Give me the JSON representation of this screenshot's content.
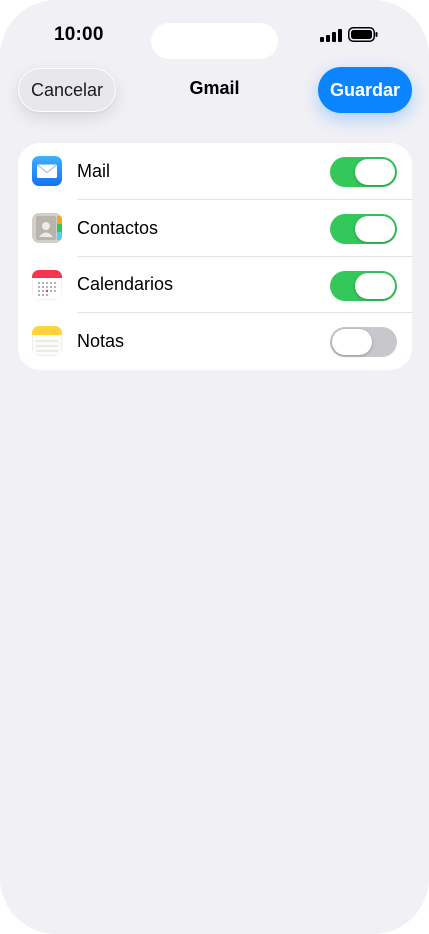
{
  "status_bar": {
    "time": "10:00"
  },
  "nav": {
    "cancel_label": "Cancelar",
    "title": "Gmail",
    "save_label": "Guardar"
  },
  "sync_items": [
    {
      "label": "Mail",
      "icon": "mail-icon",
      "enabled": true
    },
    {
      "label": "Contactos",
      "icon": "contacts-icon",
      "enabled": true
    },
    {
      "label": "Calendarios",
      "icon": "calendar-icon",
      "enabled": true
    },
    {
      "label": "Notas",
      "icon": "notes-icon",
      "enabled": false
    }
  ],
  "colors": {
    "accent": "#0a84ff",
    "toggle_on": "#34c759",
    "toggle_off": "#c7c7cc",
    "background": "#f0f0f5"
  }
}
